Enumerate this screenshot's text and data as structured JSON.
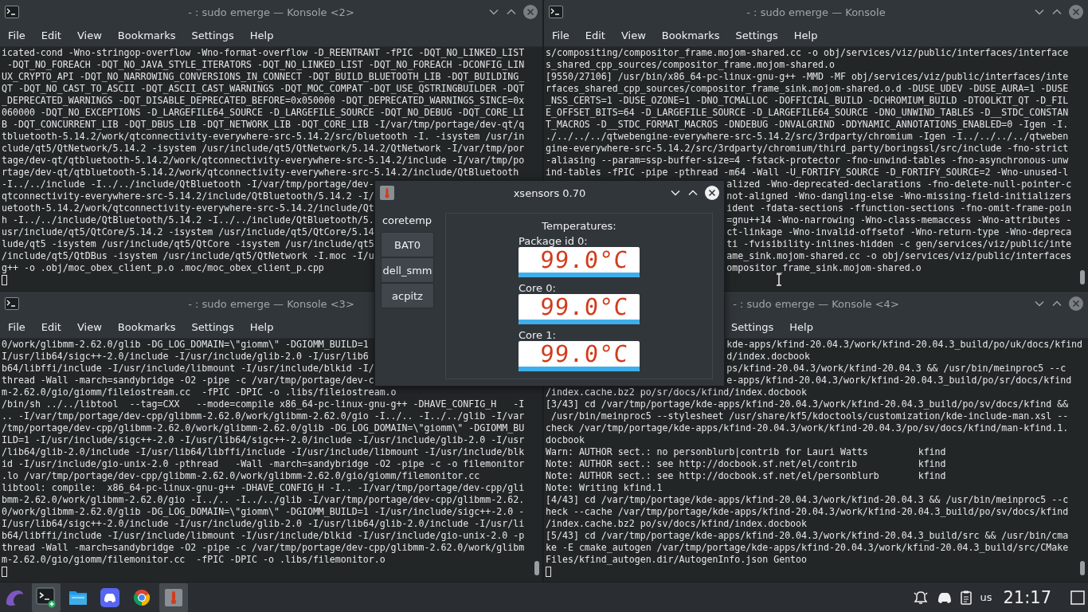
{
  "terminals": [
    {
      "title": "- : sudo emerge — Konsole <2>",
      "active": false,
      "cursor": true,
      "menu": [
        "File",
        "Edit",
        "View",
        "Bookmarks",
        "Settings",
        "Help"
      ],
      "lines": [
        {
          "text": "icated-cond -Wno-stringop-overflow -Wno-format-overflow -D_REENTRANT -fPIC -DQT_NO_LINKED_LIST"
        },
        {
          "text": " -DQT_NO_FOREACH -DQT_NO_JAVA_STYLE_ITERATORS -DQT_NO_LINKED_LIST -DQT_NO_FOREACH -DCONFIG_LIN"
        },
        {
          "text": "UX_CRYPTO_API -DQT_NO_NARROWING_CONVERSIONS_IN_CONNECT -DQT_BUILD_BLUETOOTH_LIB -DQT_BUILDING_"
        },
        {
          "text": "QT -DQT_NO_CAST_TO_ASCII -DQT_ASCII_CAST_WARNINGS -DQT_MOC_COMPAT -DQT_USE_QSTRINGBUILDER -DQT"
        },
        {
          "text": "_DEPRECATED_WARNINGS -DQT_DISABLE_DEPRECATED_BEFORE=0x050000 -DQT_DEPRECATED_WARNINGS_SINCE=0x"
        },
        {
          "text": "060000 -DQT_NO_EXCEPTIONS -D_LARGEFILE64_SOURCE -D_LARGEFILE_SOURCE -DQT_NO_DEBUG -DQT_CORE_LI"
        },
        {
          "text": "B -DQT_CONCURRENT_LIB -DQT_DBUS_LIB -DQT_NETWORK_LIB -DQT_CORE_LIB -I/var/tmp/portage/dev-qt/q"
        },
        {
          "text": "tbluetooth-5.14.2/work/qtconnectivity-everywhere-src-5.14.2/src/bluetooth -I. -isystem /usr/in"
        },
        {
          "text": "clude/qt5/QtNetwork/5.14.2 -isystem /usr/include/qt5/QtNetwork/5.14.2/QtNetwork -I/var/tmp/por"
        },
        {
          "text": "tage/dev-qt/qtbluetooth-5.14.2/work/qtconnectivity-everywhere-src-5.14.2/include -I/var/tmp/po"
        },
        {
          "text": "rtage/dev-qt/qtbluetooth-5.14.2/work/qtconnectivity-everywhere-src-5.14.2/include/QtBluetooth"
        },
        {
          "text": "-I../../include -I../../include/QtBluetooth -I/var/tmp/portage/dev-"
        },
        {
          "text": "qtconnectivity-everywhere-src-5.14.2/include/QtBluetooth/5.14.2 -I/"
        },
        {
          "text": "uetooth-5.14.2/work/qtconnectivity-everywhere-src-5.14.2/include/Qt"
        },
        {
          "text": "h -I../../include/QtBluetooth/5.14.2 -I../../include/QtBluetooth/5."
        },
        {
          "text": "usr/include/qt5/QtCore/5.14.2 -isystem /usr/include/qt5/QtCore/5.14"
        },
        {
          "text": "lude/qt5 -isystem /usr/include/qt5/QtCore -isystem /usr/include/qt5"
        },
        {
          "text": "/include/qt5/QtDBus -isystem /usr/include/qt5/QtNetwork -I.moc -I/u"
        },
        {
          "text": "g++ -o .obj/moc_obex_client_p.o .moc/moc_obex_client_p.cpp"
        }
      ]
    },
    {
      "title": "- : sudo emerge — Konsole",
      "active": false,
      "menu": [
        "File",
        "Edit",
        "View",
        "Bookmarks",
        "Settings",
        "Help"
      ],
      "lines": [
        {
          "kind": "full",
          "text": "s/compositing/compositor_frame.mojom-shared.cc -o obj/services/viz/public/interfaces/interface"
        },
        {
          "kind": "full",
          "text": "s_shared_cpp_sources/compositor_frame.mojom-shared.o"
        },
        {
          "kind": "full",
          "text": "[9550/27106] /usr/bin/x86_64-pc-linux-gnu-g++ -MMD -MF obj/services/viz/public/interfaces/inte"
        },
        {
          "kind": "full",
          "text": "rfaces_shared_cpp_sources/compositor_frame_sink.mojom-shared.o.d -DUSE_UDEV -DUSE_AURA=1 -DUSE"
        },
        {
          "kind": "full",
          "text": "_NSS_CERTS=1 -DUSE_OZONE=1 -DNO_TCMALLOC -DOFFICIAL_BUILD -DCHROMIUM_BUILD -DTOOLKIT_QT -D_FIL"
        },
        {
          "kind": "full",
          "text": "E_OFFSET_BITS=64 -D_LARGEFILE_SOURCE -D_LARGEFILE64_SOURCE -DNO_UNWIND_TABLES -D__STDC_CONSTAN"
        },
        {
          "kind": "full",
          "text": "T_MACROS -D__STDC_FORMAT_MACROS -DNDEBUG -DNVALGRIND -DDYNAMIC_ANNOTATIONS_ENABLED=0 -Igen -I."
        },
        {
          "kind": "full",
          "text": "./../../../qtwebengine-everywhere-src-5.14.2/src/3rdparty/chromium -Igen -I../../../../qtweben"
        },
        {
          "kind": "full",
          "text": "gine-everywhere-src-5.14.2/src/3rdparty/chromium/third_party/boringssl/src/include -fno-strict"
        },
        {
          "kind": "full",
          "text": "-aliasing --param=ssp-buffer-size=4 -fstack-protector -fno-unwind-tables -fno-asynchronous-unw"
        },
        {
          "kind": "full",
          "text": "ind-tables -fPIC -pipe -pthread -m64 -Wall -U_FORTIFY_SOURCE -D_FORTIFY_SOURCE=2 -Wno-unused-l"
        },
        {
          "kind": "tail",
          "text": "alized -Wno-deprecated-declarations -fno-delete-null-pointer-c"
        },
        {
          "kind": "tail",
          "text": "not-aligned -Wno-dangling-else -Wno-missing-field-initializers"
        },
        {
          "kind": "tail",
          "text": "ident -fdata-sections -ffunction-sections -fno-omit-frame-poin"
        },
        {
          "kind": "tail",
          "text": "=gnu++14 -Wno-narrowing -Wno-class-memaccess -Wno-attributes -"
        },
        {
          "kind": "tail",
          "text": "ct-linkage -Wno-invalid-offsetof -Wno-return-type -Wno-depreca"
        },
        {
          "kind": "tail",
          "text": "ti -fvisibility-inlines-hidden -c gen/services/viz/public/inte"
        },
        {
          "kind": "tail",
          "text": "ame_sink.mojom-shared.cc -o obj/services/viz/public/interfaces"
        },
        {
          "kind": "tail",
          "text": "ompositor_frame_sink.mojom-shared.o"
        }
      ]
    },
    {
      "title": "- : sudo emerge — Konsole <3>",
      "active": false,
      "cursor": true,
      "covered_right": true,
      "menu": [
        "File",
        "Edit",
        "View",
        "Bookmarks",
        "Settings",
        "Help"
      ],
      "lines": [
        {
          "text": "0/work/glibmm-2.62.0/glib -DG_LOG_DOMAIN=\\\"giomm\\\" -DGIOMM_BUILD=1"
        },
        {
          "text": "I/usr/lib64/sigc++-2.0/include -I/usr/include/glib-2.0 -I/usr/lib6"
        },
        {
          "text": "b64/libffi/include -I/usr/include/libmount -I/usr/include/blkid -I/"
        },
        {
          "text": "thread -Wall -march=sandybridge -O2 -pipe -c /var/tmp/portage/dev-c"
        },
        {
          "text": "m-2.62.0/gio/giomm/fileiostream.cc  -fPIC -DPIC -o .libs/fileiostream.o"
        },
        {
          "text": "/bin/sh ../../libtool  --tag=CXX   --mode=compile x86_64-pc-linux-gnu-g++ -DHAVE_CONFIG_H   -I"
        },
        {
          "text": ".. -I/var/tmp/portage/dev-cpp/glibmm-2.62.0/work/glibmm-2.62.0/gio -I../.. -I../../glib -I/var"
        },
        {
          "text": "/tmp/portage/dev-cpp/glibmm-2.62.0/work/glibmm-2.62.0/glib -DG_LOG_DOMAIN=\\\"giomm\\\" -DGIOMM_BU"
        },
        {
          "text": "ILD=1 -I/usr/include/sigc++-2.0 -I/usr/lib64/sigc++-2.0/include -I/usr/include/glib-2.0 -I/usr"
        },
        {
          "text": "/lib64/glib-2.0/include -I/usr/lib64/libffi/include -I/usr/include/libmount -I/usr/include/blk"
        },
        {
          "text": "id -I/usr/include/gio-unix-2.0 -pthread   -Wall -march=sandybridge -O2 -pipe -c -o filemonitor"
        },
        {
          "text": ".lo /var/tmp/portage/dev-cpp/glibmm-2.62.0/work/glibmm-2.62.0/gio/giomm/filemonitor.cc"
        },
        {
          "text": "libtool: compile:  x86_64-pc-linux-gnu-g++ -DHAVE_CONFIG_H -I.. -I/var/tmp/portage/dev-cpp/gli"
        },
        {
          "text": "bmm-2.62.0/work/glibmm-2.62.0/gio -I../.. -I../../glib -I/var/tmp/portage/dev-cpp/glibmm-2.62."
        },
        {
          "text": "0/work/glibmm-2.62.0/glib -DG_LOG_DOMAIN=\\\"giomm\\\" -DGIOMM_BUILD=1 -I/usr/include/sigc++-2.0 -"
        },
        {
          "text": "I/usr/lib64/sigc++-2.0/include -I/usr/include/glib-2.0 -I/usr/lib64/glib-2.0/include -I/usr/li"
        },
        {
          "text": "b64/libffi/include -I/usr/include/libmount -I/usr/include/blkid -I/usr/include/gio-unix-2.0 -p"
        },
        {
          "text": "thread -Wall -march=sandybridge -O2 -pipe -c /var/tmp/portage/dev-cpp/glibmm-2.62.0/work/glibm"
        },
        {
          "text": "m-2.62.0/gio/giomm/filemonitor.cc  -fPIC -DPIC -o .libs/filemonitor.o"
        }
      ]
    },
    {
      "title": "- : sudo emerge — Konsole <4>",
      "active": false,
      "cursor": true,
      "covered_left": true,
      "menu": [
        "Settings",
        "Help"
      ],
      "lines": [
        {
          "kind": "tail",
          "text": "kde-apps/kfind-20.04.3/work/kfind-20.04.3_build/po/uk/docs/kfind"
        },
        {
          "kind": "tail",
          "text": "d/index.docbook"
        },
        {
          "kind": "tail",
          "text": "ps/kfind-20.04.3/work/kfind-20.04.3 && /usr/bin/meinproc5 --c"
        },
        {
          "kind": "tail",
          "text": "e-apps/kfind-20.04.3/work/kfind-20.04.3_build/po/sr/docs/kfind"
        },
        {
          "kind": "full",
          "text": "/index.cache.bz2 po/sr/docs/kfind/index.docbook"
        },
        {
          "kind": "full",
          "text": "[3/43] cd /var/tmp/portage/kde-apps/kfind-20.04.3/work/kfind-20.04.3_build/po/sv/docs/kfind &&"
        },
        {
          "kind": "full",
          "text": " /usr/bin/meinproc5 --stylesheet /usr/share/kf5/kdoctools/customization/kde-include-man.xsl --"
        },
        {
          "kind": "full",
          "text": "check /var/tmp/portage/kde-apps/kfind-20.04.3/work/kfind-20.04.3/po/sv/docs/kfind/man-kfind.1."
        },
        {
          "kind": "full",
          "text": "docbook"
        },
        {
          "kind": "full",
          "text": "Warn: AUTHOR sect.: no personblurb|contrib for Lauri Watts         kfind"
        },
        {
          "kind": "full",
          "text": "Note: AUTHOR sect.: see http://docbook.sf.net/el/contrib           kfind"
        },
        {
          "kind": "full",
          "text": "Note: AUTHOR sect.: see http://docbook.sf.net/el/personblurb       kfind"
        },
        {
          "kind": "full",
          "text": "Note: Writing kfind.1"
        },
        {
          "kind": "full",
          "text": "[4/43] cd /var/tmp/portage/kde-apps/kfind-20.04.3/work/kfind-20.04.3 && /usr/bin/meinproc5 --c"
        },
        {
          "kind": "full",
          "text": "heck --cache /var/tmp/portage/kde-apps/kfind-20.04.3/work/kfind-20.04.3_build/po/sv/docs/kfind"
        },
        {
          "kind": "full",
          "text": "/index.cache.bz2 po/sv/docs/kfind/index.docbook"
        },
        {
          "kind": "full",
          "text": "[5/43] cd /var/tmp/portage/kde-apps/kfind-20.04.3/work/kfind-20.04.3_build/src && /usr/bin/cma"
        },
        {
          "kind": "full",
          "text": "ke -E cmake_autogen /var/tmp/portage/kde-apps/kfind-20.04.3/work/kfind-20.04.3_build/src/CMake"
        },
        {
          "kind": "full",
          "text": "Files/kfind_autogen.dir/AutogenInfo.json Gentoo"
        }
      ]
    }
  ],
  "xsensors": {
    "title": "xsensors 0.70",
    "active": true,
    "tabs": [
      {
        "label": "coretemp",
        "selected": true
      },
      {
        "label": "BAT0",
        "selected": false
      },
      {
        "label": "dell_smm",
        "selected": false
      },
      {
        "label": "acpitz",
        "selected": false
      }
    ],
    "heading": "Temperatures:",
    "sensors": [
      {
        "label": "Package id 0:",
        "value": "99.0°C",
        "level": 1
      },
      {
        "label": "Core 0:",
        "value": "99.0°C",
        "level": 1
      },
      {
        "label": "Core 1:",
        "value": "99.0°C",
        "level": 1
      }
    ]
  },
  "taskbar": {
    "tasks": [
      {
        "kind": "terminal",
        "active": true
      },
      {
        "kind": "folder",
        "active": false
      },
      {
        "kind": "controller",
        "active": false
      },
      {
        "kind": "browser",
        "active": false
      },
      {
        "kind": "thermometer",
        "active": true
      }
    ],
    "keyboard_layout": "us",
    "clock": "21:17"
  }
}
